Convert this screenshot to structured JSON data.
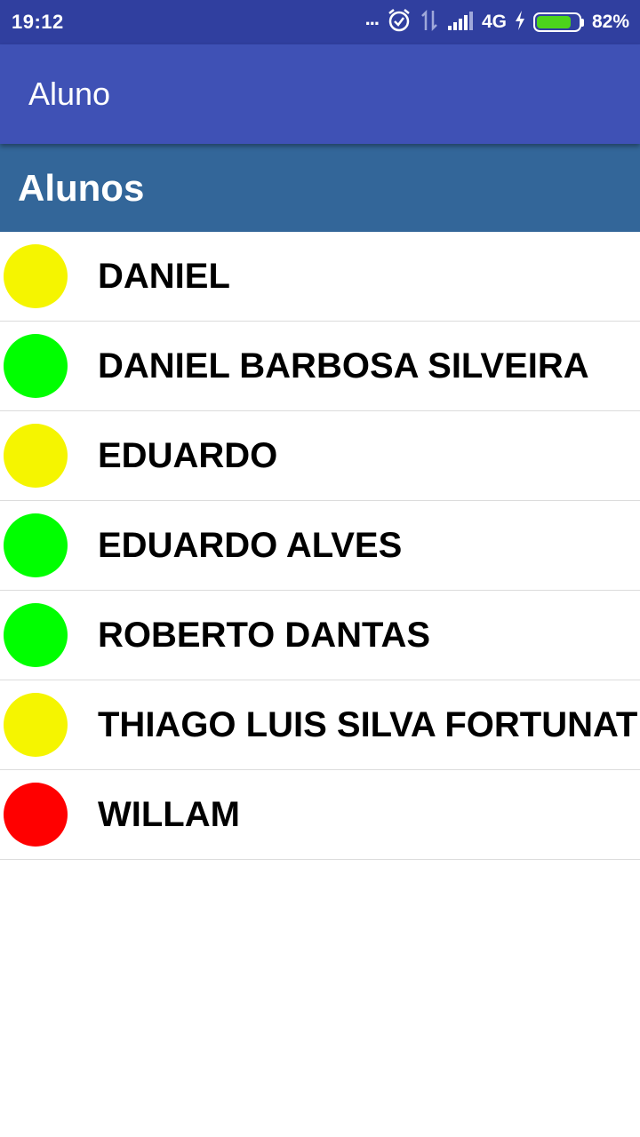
{
  "status_bar": {
    "time": "19:12",
    "dots": "...",
    "network": "4G",
    "battery_percent": "82%",
    "battery_level": 0.82,
    "icons": [
      "alarm-icon",
      "data-arrows-icon",
      "signal-icon",
      "charging-bolt-icon",
      "battery-icon"
    ]
  },
  "app_bar": {
    "title": "Aluno"
  },
  "section": {
    "title": "Alunos"
  },
  "colors": {
    "status_bar": "#303f9f",
    "app_bar": "#3f51b5",
    "section_header": "#336699",
    "yellow": "#f5f500",
    "green": "#00ff00",
    "red": "#ff0000"
  },
  "students": [
    {
      "name": "DANIEL",
      "status_color": "#f5f500"
    },
    {
      "name": "DANIEL BARBOSA SILVEIRA",
      "status_color": "#00ff00"
    },
    {
      "name": "EDUARDO",
      "status_color": "#f5f500"
    },
    {
      "name": "EDUARDO ALVES",
      "status_color": "#00ff00"
    },
    {
      "name": "ROBERTO DANTAS",
      "status_color": "#00ff00"
    },
    {
      "name": "THIAGO LUIS SILVA FORTUNAT",
      "status_color": "#f5f500"
    },
    {
      "name": "WILLAM",
      "status_color": "#ff0000"
    }
  ]
}
